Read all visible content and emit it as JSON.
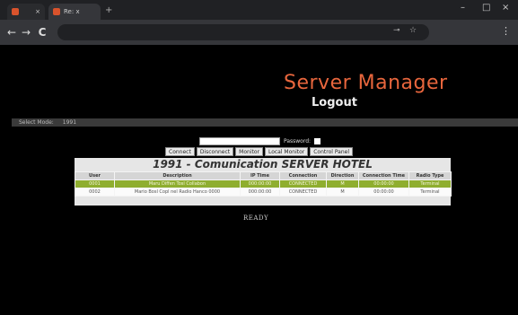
{
  "browser": {
    "tabs": [
      {
        "label": ""
      },
      {
        "label": "Re: x"
      }
    ],
    "new_tab": "+",
    "window": {
      "min": "–",
      "max": "□",
      "close": "×"
    },
    "nav": {
      "back": "←",
      "forward": "→",
      "reload": "C"
    },
    "menu": "⋮"
  },
  "header": {
    "brand": "Server Manager",
    "logout": "Logout"
  },
  "mode": {
    "label": "Select Mode:",
    "value": "1991"
  },
  "password": {
    "label": "Password:"
  },
  "buttons": [
    "Connect",
    "Disconnect",
    "Monitor",
    "Local Monitor",
    "Control Panel"
  ],
  "panel": {
    "title": "1991 - Comunication SERVER HOTEL",
    "columns": [
      "User",
      "Description",
      "IP Time",
      "Connection",
      "Direction",
      "Connection Time",
      "Radio Type"
    ],
    "rows": [
      [
        "0001",
        "Maru Diffen Tosl Collabon",
        "000:00:00",
        "CONNECTED",
        "M",
        "00:00:00",
        "Terminal"
      ],
      [
        "0002",
        "Mario Bosl Copl nel Radio Hanco 0000",
        "000:00:00",
        "CONNECTED",
        "M",
        "00:00:00",
        "Terminal"
      ]
    ]
  },
  "status": "READY",
  "colors": {
    "brand": "#e8663d",
    "selected_row": "#8fae2f",
    "background": "#000000"
  }
}
